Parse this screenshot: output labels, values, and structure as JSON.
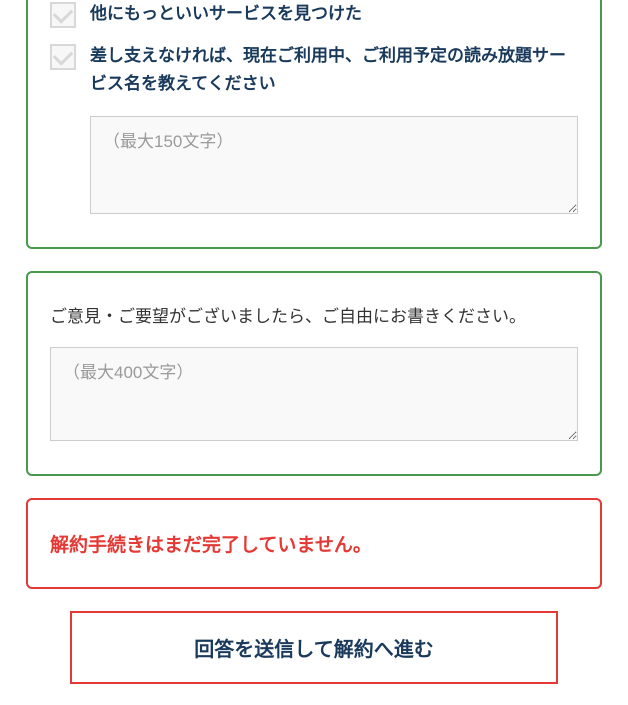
{
  "survey": {
    "option_found_better": {
      "label": "他にもっといいサービスを見つけた"
    },
    "option_service_name": {
      "label": "差し支えなければ、現在ご利用中、ご利用予定の読み放題サービス名を教えてください",
      "textarea_placeholder": "（最大150文字）"
    }
  },
  "feedback": {
    "label": "ご意見・ご要望がございましたら、ご自由にお書きください。",
    "textarea_placeholder": "（最大400文字）"
  },
  "notice": {
    "text": "解約手続きはまだ完了していません。"
  },
  "submit": {
    "label": "回答を送信して解約へ進む"
  }
}
